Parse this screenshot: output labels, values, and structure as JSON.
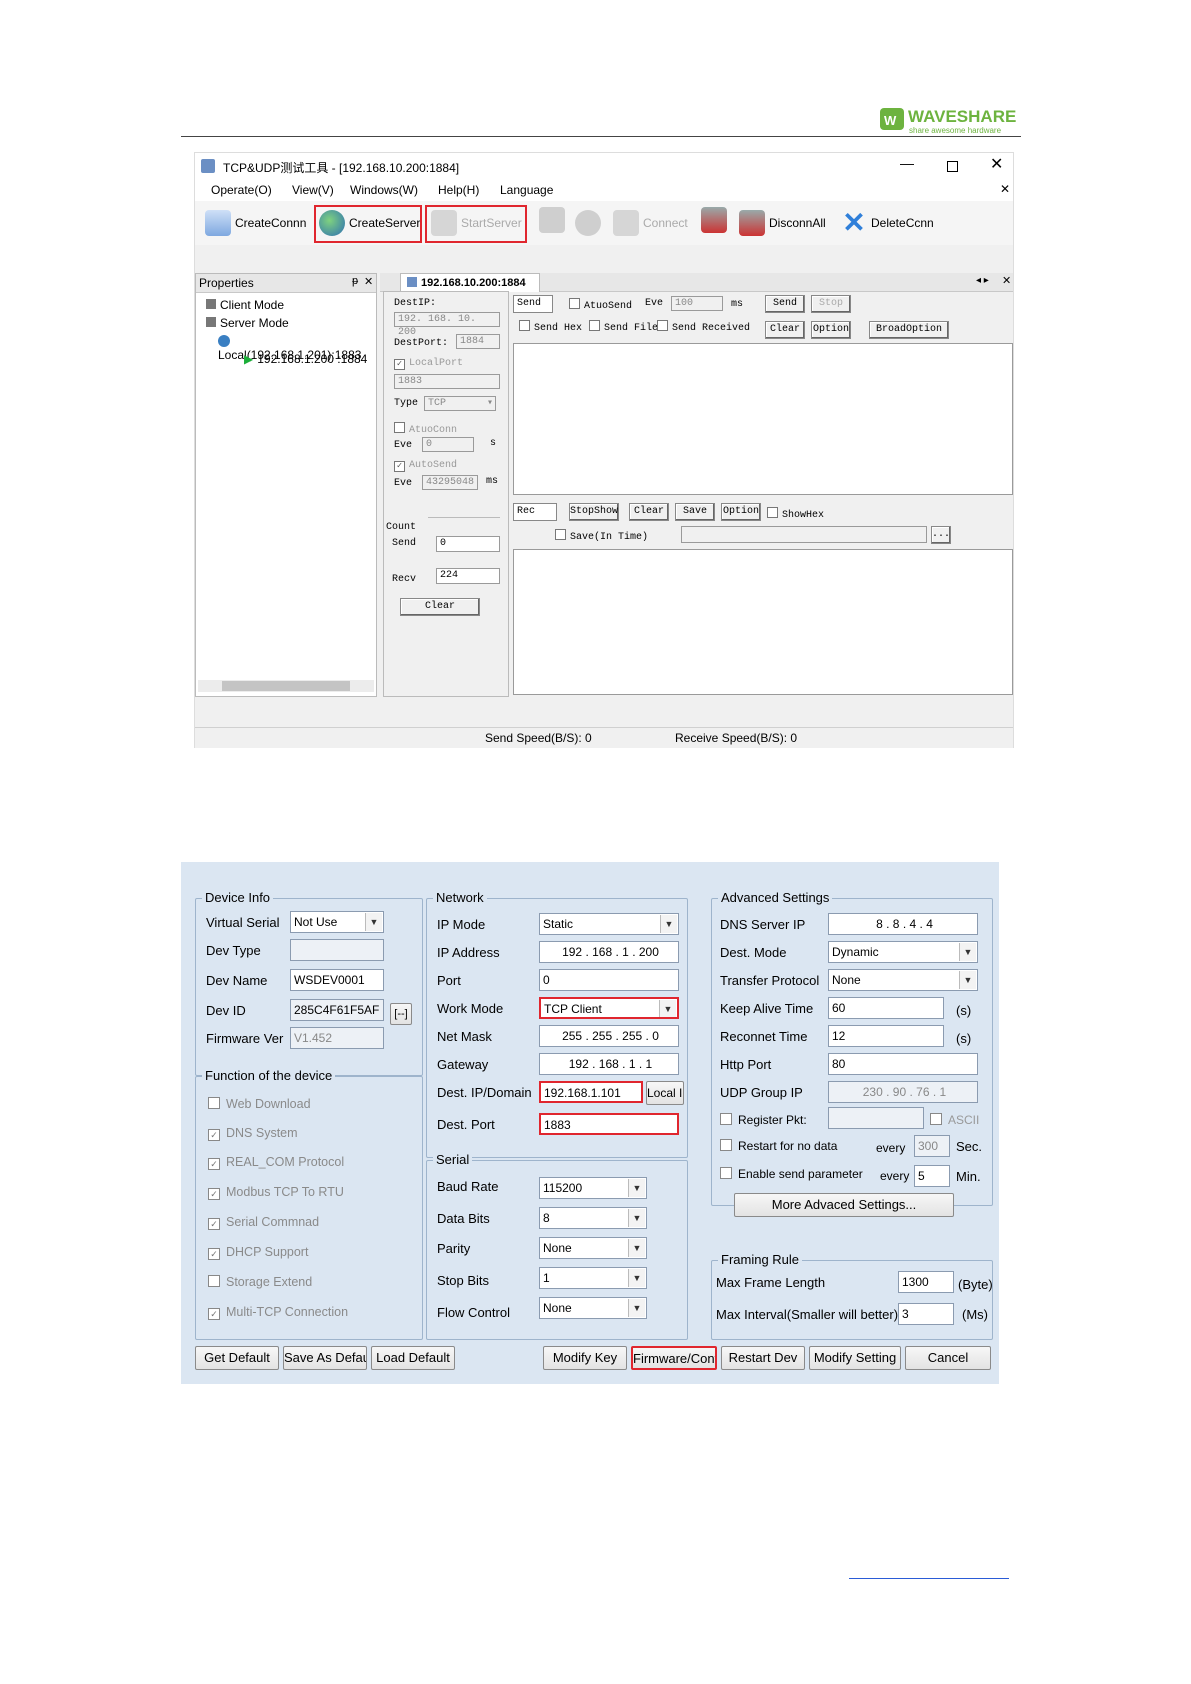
{
  "header": {
    "brand_name": "WAVESHARE",
    "brand_tagline": "share awesome hardware"
  },
  "tool_window": {
    "title": "TCP&UDP测试工具 - [192.168.10.200:1884]",
    "menu": [
      "Operate(O)",
      "View(V)",
      "Windows(W)",
      "Help(H)",
      "Language"
    ],
    "toolbar": {
      "create_conn": "CreateConnn",
      "create_server": "CreateServer",
      "start_server": "StartServer",
      "connect": "Connect",
      "disconn_all": "DisconnAll",
      "delete_conn": "DeleteCcnn"
    },
    "properties": {
      "title": "Properties",
      "client_mode": "Client Mode",
      "server_mode": "Server Mode",
      "local_node": "Local(192.168.1.201):1883",
      "conn_node": "192.168.1.200 :1884"
    },
    "tab_label": "192.168.10.200:1884",
    "left_form": {
      "dest_ip_label": "DestIP:",
      "dest_ip": "192. 168. 10. 200",
      "dest_port_label": "DestPort:",
      "dest_port": "1884",
      "local_port_label": "LocalPort",
      "local_port": "1883",
      "type_label": "Type",
      "type_value": "TCP",
      "auto_conn_label": "AtuoConn",
      "eve_label": "Eve",
      "eve_value": "0",
      "s_unit": "s",
      "auto_send_label": "AutoSend",
      "eve2_value": "43295048",
      "ms_unit": "ms",
      "count_label": "Count",
      "send_label": "Send",
      "send_count": "0",
      "recv_label": "Recv",
      "recv_count": "224",
      "clear_label": "Clear"
    },
    "send_bar": {
      "send_label": "Send",
      "auto_send": "AtuoSend",
      "eve": "Eve",
      "eve_value": "100",
      "ms": "ms",
      "send_btn": "Send",
      "stop_btn": "Stop",
      "send_hex": "Send Hex",
      "send_file": "Send File",
      "send_received": "Send Received",
      "clear_btn": "Clear",
      "option_btn": "Option",
      "broad_option": "BroadOption"
    },
    "recv_bar": {
      "rec_label": "Rec",
      "stop_show": "StopShow",
      "clear": "Clear",
      "save": "Save",
      "option": "Option",
      "show_hex": "ShowHex",
      "save_in_time": "Save(In Time)",
      "browse": "..."
    },
    "status": {
      "send_speed": "Send Speed(B/S): 0",
      "receive_speed": "Receive Speed(B/S): 0"
    }
  },
  "config_window": {
    "device_info": {
      "title": "Device Info",
      "virtual_serial_label": "Virtual Serial",
      "virtual_serial": "Not Use",
      "dev_type_label": "Dev Type",
      "dev_type": "",
      "dev_name_label": "Dev Name",
      "dev_name": "WSDEV0001",
      "dev_id_label": "Dev ID",
      "dev_id": "285C4F61F5AF",
      "dev_id_btn": "[--]",
      "firmware_label": "Firmware Ver",
      "firmware": "V1.452"
    },
    "functions": {
      "title": "Function of the device",
      "items": [
        {
          "label": "Web Download",
          "checked": false
        },
        {
          "label": "DNS System",
          "checked": true
        },
        {
          "label": "REAL_COM Protocol",
          "checked": true
        },
        {
          "label": "Modbus TCP To RTU",
          "checked": true
        },
        {
          "label": "Serial Commnad",
          "checked": true
        },
        {
          "label": "DHCP Support",
          "checked": true
        },
        {
          "label": "Storage Extend",
          "checked": false
        },
        {
          "label": "Multi-TCP Connection",
          "checked": true
        }
      ]
    },
    "network": {
      "title": "Network",
      "ip_mode_label": "IP Mode",
      "ip_mode": "Static",
      "ip_address_label": "IP Address",
      "ip_address": [
        "192",
        "168",
        "1",
        "200"
      ],
      "port_label": "Port",
      "port": "0",
      "work_mode_label": "Work Mode",
      "work_mode": "TCP Client",
      "net_mask_label": "Net Mask",
      "net_mask": [
        "255",
        "255",
        "255",
        "0"
      ],
      "gateway_label": "Gateway",
      "gateway": [
        "192",
        "168",
        "1",
        "1"
      ],
      "dest_ip_label": "Dest. IP/Domain",
      "dest_ip": "192.168.1.101",
      "local_ip_btn": "Local IP",
      "dest_port_label": "Dest. Port",
      "dest_port": "1883"
    },
    "serial": {
      "title": "Serial",
      "baud_label": "Baud Rate",
      "baud": "115200",
      "data_bits_label": "Data Bits",
      "data_bits": "8",
      "parity_label": "Parity",
      "parity": "None",
      "stop_bits_label": "Stop Bits",
      "stop_bits": "1",
      "flow_label": "Flow Control",
      "flow": "None"
    },
    "advanced": {
      "title": "Advanced Settings",
      "dns_label": "DNS Server IP",
      "dns": [
        "8",
        "8",
        "4",
        "4"
      ],
      "dest_mode_label": "Dest. Mode",
      "dest_mode": "Dynamic",
      "transfer_label": "Transfer Protocol",
      "transfer": "None",
      "keep_alive_label": "Keep Alive Time",
      "keep_alive": "60",
      "keep_alive_unit": "(s)",
      "reconnect_label": "Reconnet Time",
      "reconnect": "12",
      "reconnect_unit": "(s)",
      "http_port_label": "Http Port",
      "http_port": "80",
      "udp_group_label": "UDP Group IP",
      "udp_group": [
        "230",
        "90",
        "76",
        "1"
      ],
      "register_label": "Register Pkt:",
      "ascii_label": "ASCII",
      "restart_label": "Restart for no data",
      "every1": "every",
      "restart_value": "300",
      "restart_unit": "Sec.",
      "enable_send_label": "Enable send parameter",
      "every2": "every",
      "enable_value": "5",
      "enable_unit": "Min.",
      "more_btn": "More Advaced Settings..."
    },
    "framing": {
      "title": "Framing Rule",
      "max_frame_label": "Max Frame Length",
      "max_frame": "1300",
      "max_frame_unit": "(Byte)",
      "max_interval_label": "Max Interval(Smaller will better)",
      "max_interval": "3",
      "max_interval_unit": "(Ms)"
    },
    "buttons": {
      "get_default": "Get Default",
      "save_default": "Save As Default",
      "load_default": "Load Default",
      "modify_key": "Modify Key",
      "firmware_config": "Firmware/Config",
      "restart_dev": "Restart Dev",
      "modify_setting": "Modify Setting",
      "cancel": "Cancel"
    }
  },
  "colors": {
    "highlight_red": "#e0262e",
    "config_bg": "#dbe6f2",
    "brand_green": "#6db33f"
  }
}
